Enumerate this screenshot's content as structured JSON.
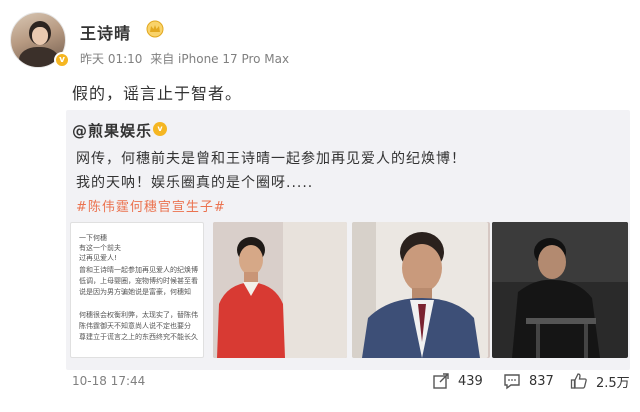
{
  "post": {
    "user_name": "王诗晴",
    "time": "昨天 01:10",
    "source": "来自 iPhone 17 Pro Max",
    "text": "假的，谣言止于智者。"
  },
  "repost": {
    "author": "@煎果娱乐",
    "line1": "网传，何穗前夫是曾和王诗晴一起参加再见爱人的纪焕博！",
    "line2": "我的天呐！娱乐圈真的是个圈呀.....",
    "hashtag": "#陈伟霆何穗官宣生子#",
    "doc_lines": [
      "一下何穗",
      "有这一个前夫",
      "过再见爱人!",
      "曾和王诗晴一起参加再见爱人的纪焕博",
      "低调，上母婴圈，宠物博约时候甚至看",
      "说是因为男方骗她说是富豪，何穗知",
      "",
      "何穗很会权衡利弊，太现实了，替陈伟",
      "陈伟霆御天不知意尚人说不定也要分",
      "尊建立于谎言之上的东西终究不能长久"
    ]
  },
  "footer": {
    "timestamp": "10-18 17:44",
    "share_count": "439",
    "comment_count": "837",
    "like_count": "2.5万"
  },
  "colors": {
    "hashtag": "#eb7350",
    "verify_badge": "#f5b622",
    "meta_text": "#808080",
    "repost_bg": "#f2f2f5"
  }
}
